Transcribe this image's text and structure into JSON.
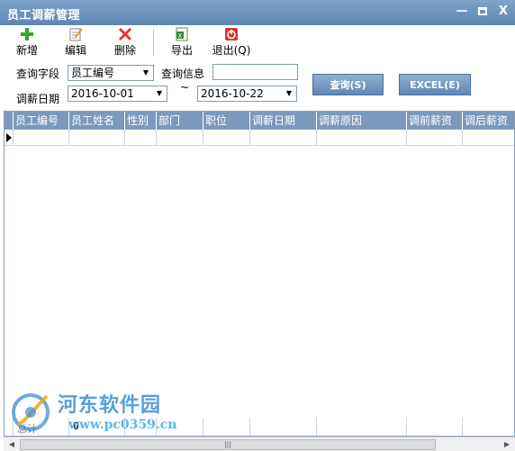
{
  "window": {
    "title": "员工调薪管理",
    "controls": {
      "minimize": "—",
      "close": "X"
    }
  },
  "toolbar": {
    "add_label": "新增",
    "edit_label": "编辑",
    "delete_label": "删除",
    "export_label": "导出",
    "exit_label": "退出(Q)"
  },
  "query": {
    "field_label": "查询字段",
    "field_value": "员工编号",
    "info_label": "查询信息",
    "info_value": "",
    "date_label": "调薪日期",
    "date_from": "2016-10-01",
    "date_to": "2016-10-22",
    "separator": "~",
    "search_button": "查询(S)",
    "excel_button": "EXCEL(E)"
  },
  "grid": {
    "columns": [
      "员工编号",
      "员工姓名",
      "性别",
      "部门",
      "职位",
      "调薪日期",
      "调薪原因",
      "调前薪资",
      "调后薪资"
    ],
    "rows": [],
    "footer_label": "总计",
    "footer_count": "0"
  },
  "watermark": {
    "title": "河东软件园",
    "url": "www.pc0359.cn"
  },
  "icons": {
    "add": "plus-icon",
    "edit": "notepad-pencil-icon",
    "delete": "red-x-icon",
    "export": "excel-export-icon",
    "exit": "power-icon"
  },
  "colors": {
    "titlebar": "#6f96c2",
    "grid_header": "#7c99bd",
    "button": "#6f95c0",
    "watermark": "#3a8fd4"
  }
}
